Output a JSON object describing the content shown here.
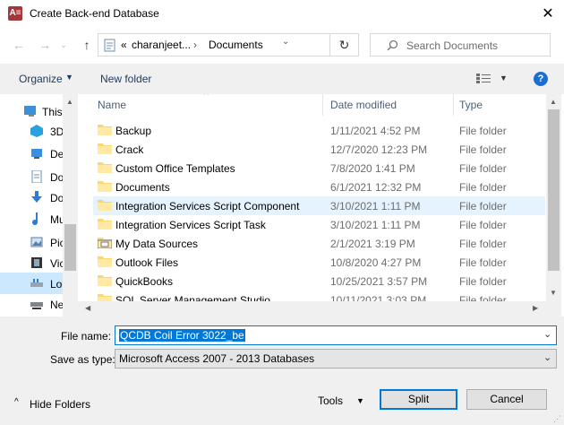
{
  "window": {
    "title": "Create Back-end Database",
    "app_icon_text": "A≡",
    "close_glyph": "✕"
  },
  "address": {
    "prefix": "«",
    "crumbs": [
      "charanjeet...",
      "Documents"
    ],
    "separator": "›",
    "search_placeholder": "Search Documents"
  },
  "toolbar": {
    "organize_label": "Organize",
    "new_folder_label": "New folder",
    "help_glyph": "?"
  },
  "sidebar": {
    "items": [
      {
        "label": "This",
        "icon": "pc-icon"
      },
      {
        "label": "3D",
        "icon": "3d-objects-icon"
      },
      {
        "label": "De",
        "icon": "desktop-icon"
      },
      {
        "label": "Do",
        "icon": "documents-icon"
      },
      {
        "label": "Do",
        "icon": "downloads-icon"
      },
      {
        "label": "Mu",
        "icon": "music-icon"
      },
      {
        "label": "Pic",
        "icon": "pictures-icon"
      },
      {
        "label": "Vic",
        "icon": "videos-icon"
      },
      {
        "label": "Lo",
        "icon": "local-disk-icon"
      },
      {
        "label": "Ne",
        "icon": "network-drive-icon"
      }
    ]
  },
  "columns": {
    "name": "Name",
    "date": "Date modified",
    "type": "Type"
  },
  "files": [
    {
      "name": "Backup",
      "date": "1/11/2021 4:52 PM",
      "type": "File folder"
    },
    {
      "name": "Crack",
      "date": "12/7/2020 12:23 PM",
      "type": "File folder"
    },
    {
      "name": "Custom Office Templates",
      "date": "7/8/2020 1:41 PM",
      "type": "File folder"
    },
    {
      "name": "Documents",
      "date": "6/1/2021 12:32 PM",
      "type": "File folder"
    },
    {
      "name": "Integration Services Script Component",
      "date": "3/10/2021 1:11 PM",
      "type": "File folder"
    },
    {
      "name": "Integration Services Script Task",
      "date": "3/10/2021 1:11 PM",
      "type": "File folder"
    },
    {
      "name": "My Data Sources",
      "date": "2/1/2021 3:19 PM",
      "type": "File folder"
    },
    {
      "name": "Outlook Files",
      "date": "10/8/2020 4:27 PM",
      "type": "File folder"
    },
    {
      "name": "QuickBooks",
      "date": "10/25/2021 3:57 PM",
      "type": "File folder"
    },
    {
      "name": "SQL Server Management Studio",
      "date": "10/11/2021 3:03 PM",
      "type": "File folder"
    }
  ],
  "form": {
    "file_name_label": "File name:",
    "file_name_value": "QCDB Coil Error 3022_be",
    "save_type_label": "Save as type:",
    "save_type_value": "Microsoft Access 2007 - 2013 Databases"
  },
  "footer": {
    "hide_folders_label": "Hide Folders",
    "tools_label": "Tools",
    "split_label": "Split",
    "cancel_label": "Cancel"
  },
  "colors": {
    "accent": "#0078d7",
    "folder": "#f8d775",
    "hover_row": "#e5f3ff",
    "header_text": "#4c607a"
  }
}
